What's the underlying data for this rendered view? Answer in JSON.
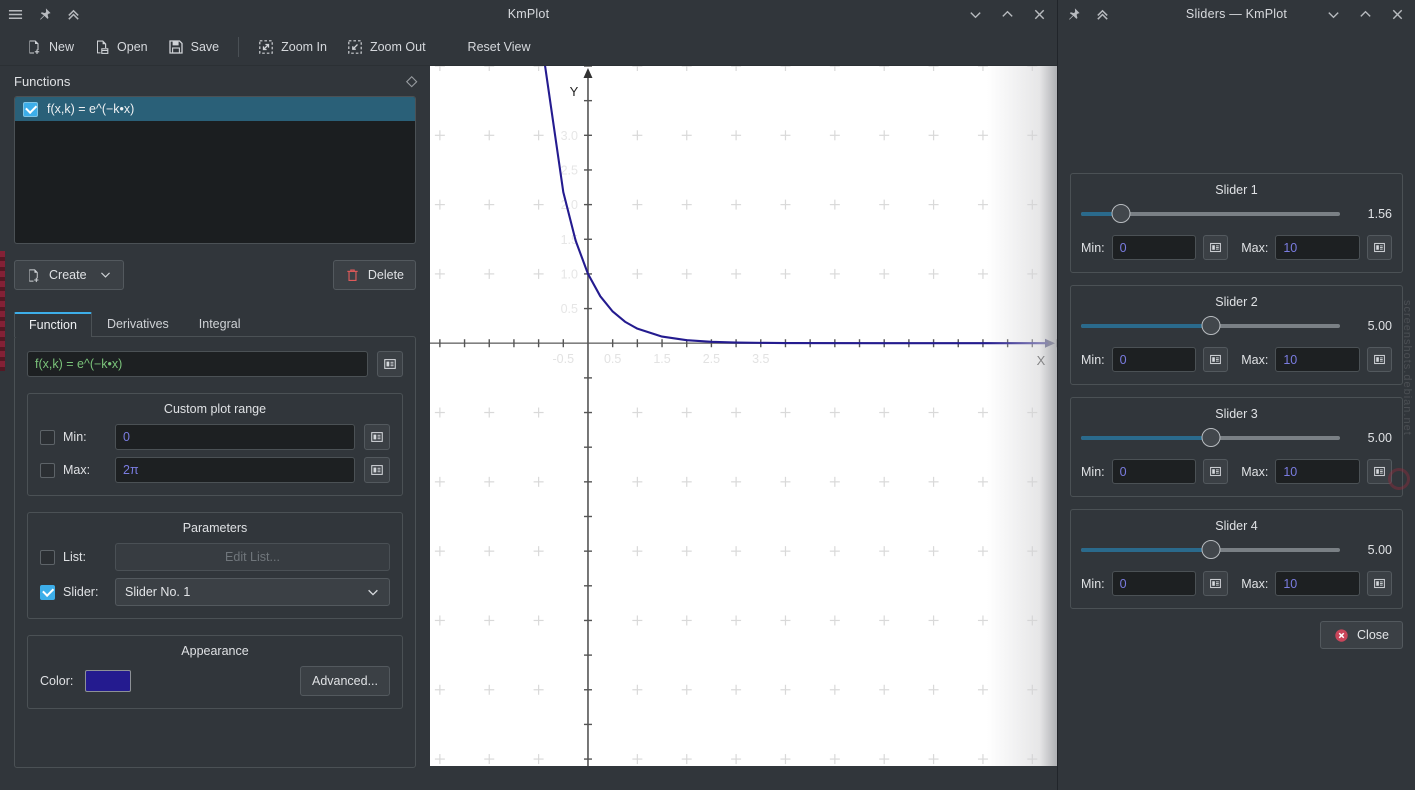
{
  "main_window": {
    "title": "KmPlot",
    "titlebar_icons": [
      "hamburger-menu-icon",
      "pin-icon",
      "collapse-icon"
    ],
    "window_controls": [
      "minimize-icon",
      "maximize-icon",
      "close-icon"
    ],
    "toolbar": {
      "new_label": "New",
      "open_label": "Open",
      "save_label": "Save",
      "zoom_in_label": "Zoom In",
      "zoom_out_label": "Zoom Out",
      "reset_view_label": "Reset View"
    }
  },
  "functions_dock": {
    "title": "Functions",
    "items": [
      {
        "label": "f(x,k) = e^(−k•x)",
        "checked": true,
        "selected": true
      }
    ],
    "create_label": "Create",
    "delete_label": "Delete"
  },
  "editor": {
    "tabs": [
      {
        "label": "Function",
        "active": true
      },
      {
        "label": "Derivatives",
        "active": false
      },
      {
        "label": "Integral",
        "active": false
      }
    ],
    "equation": "f(x,k) = e^(−k•x)",
    "custom_plot_range": {
      "title": "Custom plot range",
      "min_label": "Min:",
      "min_value": "0",
      "min_checked": false,
      "max_label": "Max:",
      "max_value": "2π",
      "max_checked": false
    },
    "parameters": {
      "title": "Parameters",
      "list_label": "List:",
      "list_checked": false,
      "edit_list_label": "Edit List...",
      "slider_label": "Slider:",
      "slider_checked": true,
      "slider_selected": "Slider No. 1"
    },
    "appearance": {
      "title": "Appearance",
      "color_label": "Color:",
      "color_value": "#241b8f",
      "advanced_label": "Advanced..."
    }
  },
  "sliders_window": {
    "title": "Sliders — KmPlot",
    "titlebar_icons": [
      "pin-icon",
      "collapse-icon"
    ],
    "window_controls": [
      "minimize-icon",
      "maximize-icon",
      "close-icon"
    ],
    "min_label": "Min:",
    "max_label": "Max:",
    "sliders": [
      {
        "name": "Slider 1",
        "value": "1.56",
        "percent": 15.6,
        "min": "0",
        "max": "10"
      },
      {
        "name": "Slider 2",
        "value": "5.00",
        "percent": 50,
        "min": "0",
        "max": "10"
      },
      {
        "name": "Slider 3",
        "value": "5.00",
        "percent": 50,
        "min": "0",
        "max": "10"
      },
      {
        "name": "Slider 4",
        "value": "5.00",
        "percent": 50,
        "min": "0",
        "max": "10"
      }
    ],
    "close_label": "Close"
  },
  "watermark": {
    "text": "screenshots.debian.net"
  },
  "chart_data": {
    "type": "line",
    "title": "",
    "xlabel": "X",
    "ylabel": "Y",
    "expression": "f(x,k) = e^(−k•x)",
    "k": 1.56,
    "line_color": "#241b8f",
    "grid": "crosses",
    "xlim": [
      -3.2,
      9.5
    ],
    "ylim": [
      -6.1,
      4.0
    ],
    "xticks": [
      -0.5,
      0.5,
      1.5,
      2.5,
      3.5
    ],
    "yticks": [
      0.5,
      1.0,
      1.5,
      2.0,
      2.5,
      3.0
    ],
    "tick_step": 0.5,
    "axis_color": "#808080",
    "points": [
      {
        "x": -0.95,
        "y": 4.4
      },
      {
        "x": -0.5,
        "y": 2.18
      },
      {
        "x": -0.25,
        "y": 1.48
      },
      {
        "x": 0,
        "y": 1.0
      },
      {
        "x": 0.25,
        "y": 0.677
      },
      {
        "x": 0.5,
        "y": 0.458
      },
      {
        "x": 0.75,
        "y": 0.31
      },
      {
        "x": 1.0,
        "y": 0.21
      },
      {
        "x": 1.5,
        "y": 0.096
      },
      {
        "x": 2.0,
        "y": 0.044
      },
      {
        "x": 2.5,
        "y": 0.02
      },
      {
        "x": 3.0,
        "y": 0.009
      },
      {
        "x": 4.0,
        "y": 0.002
      },
      {
        "x": 6.0,
        "y": 0.0001
      },
      {
        "x": 9.3,
        "y": 0.0
      }
    ]
  }
}
